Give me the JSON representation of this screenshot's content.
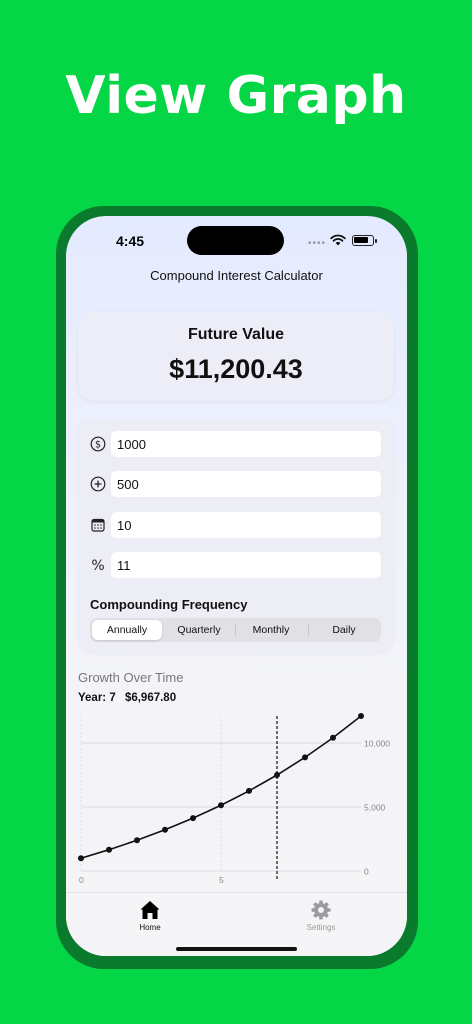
{
  "promo": {
    "headline": "View Graph"
  },
  "status_bar": {
    "time": "4:45",
    "signal": "••••"
  },
  "app": {
    "title": "Compound Interest Calculator"
  },
  "future": {
    "label": "Future Value",
    "value": "$11,200.43"
  },
  "inputs": [
    {
      "icon": "dollar-circle-icon",
      "value": "1000"
    },
    {
      "icon": "plus-circle-icon",
      "value": "500"
    },
    {
      "icon": "calendar-icon",
      "value": "10"
    },
    {
      "icon": "percent-icon",
      "value": "11"
    }
  ],
  "frequency": {
    "label": "Compounding Frequency",
    "options": [
      "Annually",
      "Quarterly",
      "Monthly",
      "Daily"
    ],
    "selected": "Annually"
  },
  "growth": {
    "title": "Growth Over Time",
    "year_label": "Year: 7",
    "year_value": "$6,967.80"
  },
  "chart_data": {
    "type": "line",
    "x": [
      0,
      1,
      2,
      3,
      4,
      5,
      6,
      7,
      8,
      9,
      10
    ],
    "values": [
      1000,
      1665,
      2403,
      3222,
      4131,
      5140,
      6260,
      7503,
      8883,
      10415,
      12115
    ],
    "x_ticks": [
      "0",
      "5"
    ],
    "y_ticks": [
      "10,000",
      "5,000",
      "0"
    ],
    "xlim": [
      0,
      10
    ],
    "ylim": [
      0,
      12115
    ],
    "highlight_x": 7,
    "grid": true,
    "colors": {
      "line": "#111111",
      "grid": "#d4d4d8",
      "marker": "#111111"
    }
  },
  "tabs": [
    {
      "label": "Home",
      "icon": "house-icon",
      "active": true
    },
    {
      "label": "Settings",
      "icon": "gear-icon",
      "active": false
    }
  ]
}
